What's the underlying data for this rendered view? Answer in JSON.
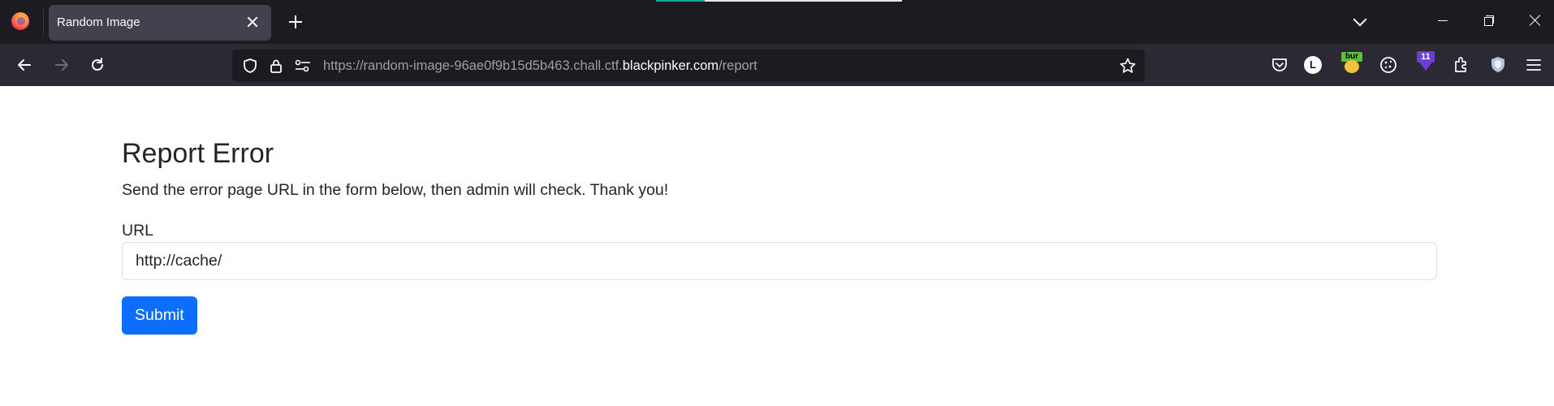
{
  "browser": {
    "tab_title": "Random Image",
    "url_prefix": "https://random-image-96ae0f9b15d5b463.chall.ctf.",
    "url_domain": "blackpinker.com",
    "url_path": "/report",
    "extensions": {
      "account_initial": "L",
      "bur_label": "bur",
      "badge_count": "11"
    }
  },
  "page": {
    "title": "Report Error",
    "description": "Send the error page URL in the form below, then admin will check. Thank you!",
    "url_label": "URL",
    "url_value": "http://cache/",
    "submit_label": "Submit",
    "accent_color": "#0d6efd"
  }
}
